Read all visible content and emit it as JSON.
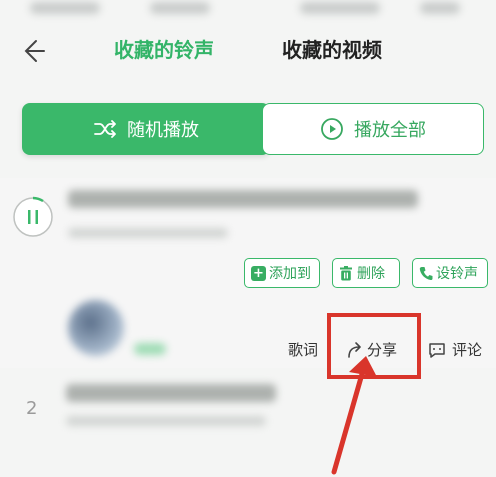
{
  "header": {
    "back_icon": "arrow-left-icon",
    "tabs": [
      {
        "label": "收藏的铃声",
        "active": true
      },
      {
        "label": "收藏的视频",
        "active": false
      }
    ]
  },
  "actions": {
    "shuffle_label": "随机播放",
    "shuffle_icon": "shuffle-icon",
    "play_all_label": "播放全部",
    "play_all_icon": "play-circle-icon"
  },
  "songs": [
    {
      "index": "",
      "state": "paused-icon",
      "options": {
        "add_to": "添加到",
        "delete": "删除",
        "set_ringtone": "设铃声"
      },
      "extras": {
        "lyrics": "歌词",
        "share": "分享",
        "comment": "评论"
      }
    },
    {
      "index": "2"
    }
  ],
  "colors": {
    "accent": "#3ab86a",
    "highlight": "#d9352b"
  }
}
